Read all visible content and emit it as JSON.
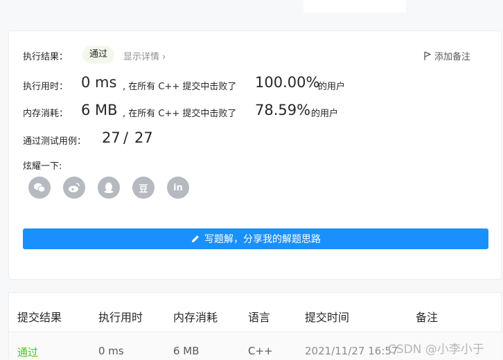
{
  "result": {
    "label": "执行结果：",
    "status": "通过",
    "detail_link": "显示详情 ›",
    "add_note": "添加备注"
  },
  "runtime": {
    "label": "执行用时：",
    "value": "0 ms",
    "mid": ", 在所有 C++ 提交中击败了",
    "percent": "100.00%",
    "suffix": "的用户"
  },
  "memory": {
    "label": "内存消耗：",
    "value": "6 MB",
    "mid": ", 在所有 C++ 提交中击败了",
    "percent": "78.59%",
    "suffix": "的用户"
  },
  "tests": {
    "label": "通过测试用例：",
    "passed": "27",
    "slash": "/",
    "total": "27"
  },
  "share": {
    "label": "炫耀一下:",
    "icons": [
      "wechat-icon",
      "weibo-icon",
      "qq-icon",
      "douban-icon",
      "linkedin-icon"
    ],
    "douban_glyph": "豆",
    "linkedin_glyph": "in"
  },
  "solve_button": "写题解，分享我的解题思路",
  "table": {
    "headers": [
      "提交结果",
      "执行用时",
      "内存消耗",
      "语言",
      "提交时间",
      "备注"
    ],
    "row": {
      "result": "通过",
      "time": "0 ms",
      "memory": "6 MB",
      "language": "C++",
      "submitted": "2021/11/27 16:57"
    }
  },
  "colors": {
    "accent": "#1a90ff",
    "pass": "#52c41a",
    "icon_gray": "#b5b9c0"
  },
  "watermark": "CSDN @小李小于"
}
